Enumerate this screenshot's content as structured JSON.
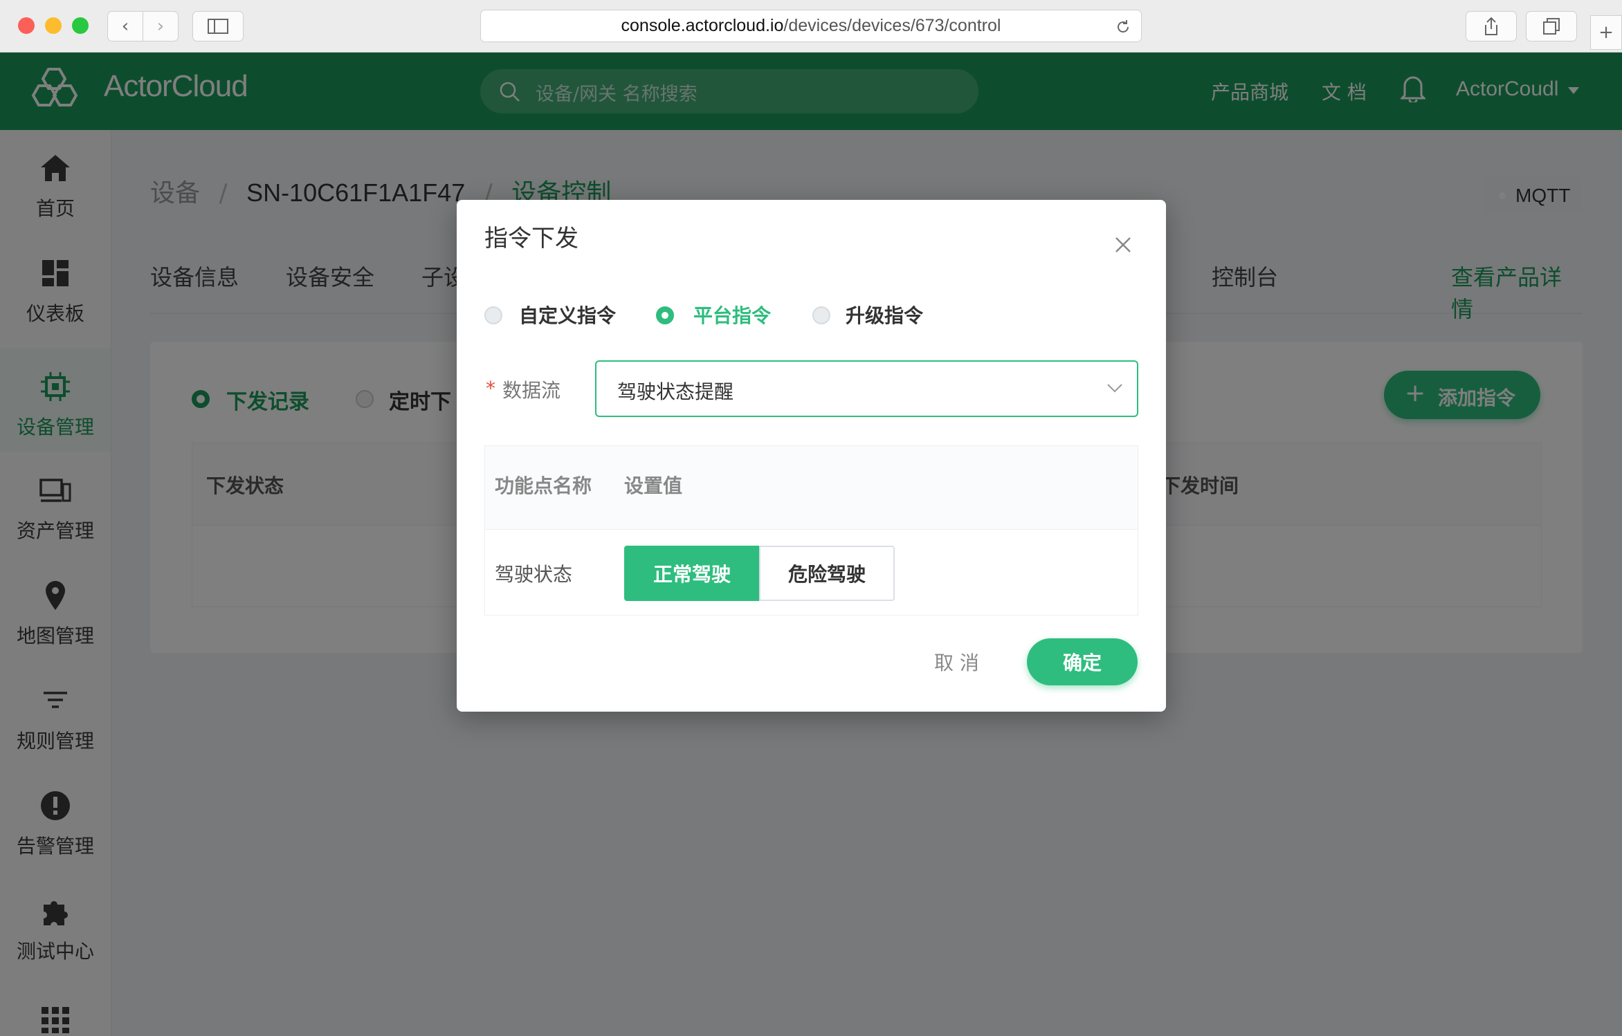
{
  "browser": {
    "url_host": "console.actorcloud.io",
    "url_path": "/devices/devices/673/control"
  },
  "header": {
    "logo_text": "ActorCloud",
    "search_placeholder": "设备/网关 名称搜索",
    "nav_store": "产品商城",
    "nav_docs": "文 档",
    "user_name": "ActorCoudl"
  },
  "sidebar": {
    "items": [
      {
        "label": "首页",
        "icon": "home-icon"
      },
      {
        "label": "仪表板",
        "icon": "dashboard-icon"
      },
      {
        "label": "设备管理",
        "icon": "chip-icon",
        "active": true
      },
      {
        "label": "资产管理",
        "icon": "devices-icon"
      },
      {
        "label": "地图管理",
        "icon": "map-pin-icon"
      },
      {
        "label": "规则管理",
        "icon": "filter-icon"
      },
      {
        "label": "告警管理",
        "icon": "alert-icon"
      },
      {
        "label": "测试中心",
        "icon": "puzzle-icon"
      }
    ]
  },
  "main": {
    "breadcrumb": [
      "设备",
      "SN-10C61F1A1F47",
      "设备控制"
    ],
    "protocol_badge": "MQTT",
    "tabs": [
      "设备信息",
      "设备安全",
      "子设",
      "控制台"
    ],
    "view_product_link": "查看产品详情",
    "sub_tabs": [
      "下发记录",
      "定时下"
    ],
    "add_button": "添加指令",
    "table_headers": [
      "下发状态",
      "下发时间"
    ]
  },
  "modal": {
    "title": "指令下发",
    "command_types": [
      {
        "label": "自定义指令",
        "selected": false
      },
      {
        "label": "平台指令",
        "selected": true
      },
      {
        "label": "升级指令",
        "selected": false
      }
    ],
    "required_mark": "*",
    "stream_label": "数据流",
    "stream_value": "驾驶状态提醒",
    "table": {
      "headers": [
        "功能点名称",
        "设置值"
      ],
      "rows": [
        {
          "name": "驾驶状态",
          "options": [
            "正常驾驶",
            "危险驾驶"
          ],
          "selected": "正常驾驶"
        }
      ]
    },
    "cancel_label": "取 消",
    "confirm_label": "确定"
  },
  "colors": {
    "brand_green": "#1a9a5a",
    "accent_green": "#2ebd7e",
    "overlay": "rgba(0,0,0,0.5)"
  }
}
